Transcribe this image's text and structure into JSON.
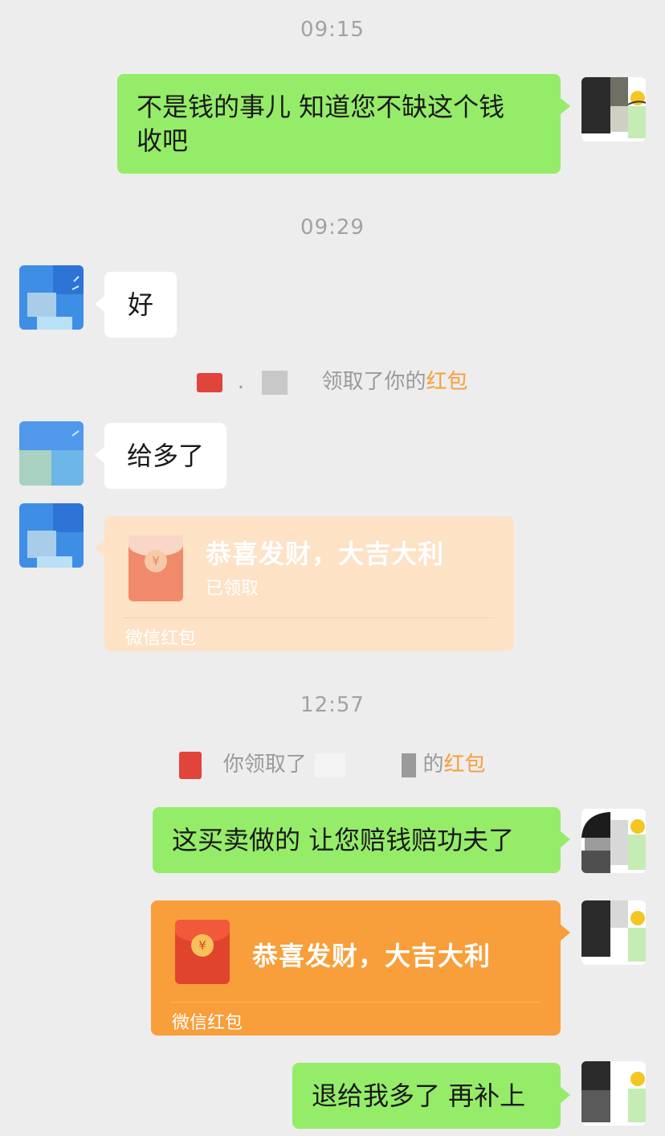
{
  "chat": {
    "timestamps": [
      "09:15",
      "09:29",
      "12:57"
    ],
    "messages": [
      {
        "from": "me",
        "type": "text",
        "lines": [
          "不是钱的事儿 知道您不缺这个钱",
          "收吧"
        ]
      },
      {
        "from": "other",
        "type": "text",
        "text": "好"
      },
      {
        "from": "other",
        "type": "text",
        "text": "给多了"
      },
      {
        "from": "me",
        "type": "text",
        "text": "这买卖做的 让您赔钱赔功夫了"
      },
      {
        "from": "me",
        "type": "text",
        "text": "退给我多了 再补上"
      }
    ],
    "system_notices": [
      {
        "before": ".",
        "middle": "领取了你的",
        "highlight": "红包"
      },
      {
        "before": "你领取了",
        "middle": "的",
        "highlight": "红包"
      }
    ],
    "red_packets": [
      {
        "from": "other",
        "title": "恭喜发财，大吉大利",
        "status": "已领取",
        "footer": "微信红包",
        "opened": true,
        "seal": "¥"
      },
      {
        "from": "me",
        "title": "恭喜发财，大吉大利",
        "footer": "微信红包",
        "opened": false,
        "seal": "¥"
      }
    ]
  },
  "colors": {
    "background": "#ededed",
    "my_bubble": "#95ec69",
    "their_bubble": "#ffffff",
    "packet_opened": "#fde2c6",
    "packet_unopened": "#f89e3a",
    "highlight": "#f89e3a"
  }
}
